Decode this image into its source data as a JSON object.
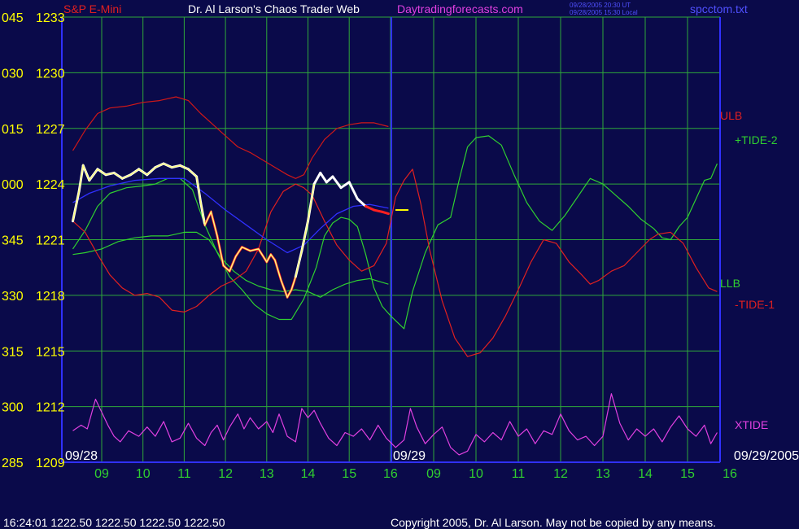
{
  "header": {
    "symbol": "S&P E-Mini",
    "title": "Dr. Al Larson's Chaos Trader Web",
    "site": "Daytradingforecasts.com",
    "time_ut": "09/28/2005 20:30 UT",
    "time_local": "09/28/2005 15:30 Local",
    "file": "spcctom.txt"
  },
  "footer": {
    "status": "16:24:01  1222.50  1222.50  1222.50  1222.50",
    "copyright": "Copyright 2005, Dr. Al Larson. May not be copied by any means."
  },
  "colors": {
    "background": "#0a0a4a",
    "grid": "#2fa83a",
    "price": "#ffffff",
    "price_down": "#ff2020",
    "ma_yellow": "#ffff80",
    "bands": "#d01818",
    "tide_plus": "#30d030",
    "tide_minus": "#e02020",
    "xtide": "#e040e0",
    "axis_blue": "#3030ff"
  },
  "chart_data": {
    "type": "line",
    "y_ticks": [
      {
        "angle": "045",
        "price": "1233"
      },
      {
        "angle": "030",
        "price": "1230"
      },
      {
        "angle": "015",
        "price": "1227"
      },
      {
        "angle": "000",
        "price": "1224"
      },
      {
        "angle": "345",
        "price": "1221"
      },
      {
        "angle": "330",
        "price": "1218"
      },
      {
        "angle": "315",
        "price": "1215"
      },
      {
        "angle": "300",
        "price": "1212"
      },
      {
        "angle": "285",
        "price": "1209"
      }
    ],
    "ylim": [
      1209,
      1233
    ],
    "x_ticks": [
      "09",
      "10",
      "11",
      "12",
      "13",
      "14",
      "15",
      "16",
      "09",
      "10",
      "11",
      "12",
      "13",
      "14",
      "15",
      "16"
    ],
    "date_labels": [
      "09/28",
      "09/29",
      "09/29/2005"
    ],
    "x_range_hours": [
      8.3,
      16
    ],
    "series_labels": {
      "ulb": "ULB",
      "tide_plus": "+TIDE-2",
      "llb": "LLB",
      "tide_minus": "-TIDE-1",
      "xtide": "XTIDE"
    },
    "price_path": [
      [
        8.3,
        1222.0
      ],
      [
        8.45,
        1223.6
      ],
      [
        8.55,
        1225.0
      ],
      [
        8.7,
        1224.2
      ],
      [
        8.9,
        1224.8
      ],
      [
        9.1,
        1224.5
      ],
      [
        9.3,
        1224.6
      ],
      [
        9.5,
        1224.3
      ],
      [
        9.7,
        1224.5
      ],
      [
        9.9,
        1224.8
      ],
      [
        10.1,
        1224.5
      ],
      [
        10.3,
        1224.9
      ],
      [
        10.5,
        1225.1
      ],
      [
        10.7,
        1224.9
      ],
      [
        10.9,
        1225.0
      ],
      [
        11.1,
        1224.8
      ],
      [
        11.3,
        1224.4
      ],
      [
        11.4,
        1223.0
      ],
      [
        11.5,
        1221.8
      ],
      [
        11.65,
        1222.5
      ],
      [
        11.8,
        1221.2
      ],
      [
        11.95,
        1219.6
      ],
      [
        12.1,
        1219.3
      ],
      [
        12.25,
        1220.1
      ],
      [
        12.4,
        1220.6
      ],
      [
        12.6,
        1220.4
      ],
      [
        12.8,
        1220.5
      ],
      [
        13.0,
        1219.8
      ],
      [
        13.1,
        1220.2
      ],
      [
        13.2,
        1219.9
      ],
      [
        13.35,
        1218.8
      ],
      [
        13.5,
        1217.9
      ],
      [
        13.6,
        1218.3
      ],
      [
        13.7,
        1219.0
      ],
      [
        13.85,
        1220.4
      ],
      [
        14.0,
        1222.0
      ],
      [
        14.15,
        1224.0
      ],
      [
        14.3,
        1224.6
      ],
      [
        14.45,
        1224.1
      ],
      [
        14.6,
        1224.4
      ],
      [
        14.8,
        1223.8
      ],
      [
        15.0,
        1224.1
      ],
      [
        15.2,
        1223.2
      ],
      [
        15.4,
        1222.8
      ],
      [
        15.6,
        1222.6
      ],
      [
        15.8,
        1222.5
      ],
      [
        15.95,
        1222.4
      ]
    ],
    "tide_plus_path": [
      [
        8.3,
        1220.5
      ],
      [
        8.6,
        1221.5
      ],
      [
        8.9,
        1222.8
      ],
      [
        9.2,
        1223.5
      ],
      [
        9.6,
        1223.8
      ],
      [
        10.0,
        1223.9
      ],
      [
        10.3,
        1224.0
      ],
      [
        10.6,
        1224.3
      ],
      [
        10.9,
        1224.3
      ],
      [
        11.2,
        1223.7
      ],
      [
        11.5,
        1221.8
      ],
      [
        11.8,
        1220.3
      ],
      [
        12.1,
        1219.0
      ],
      [
        12.4,
        1218.3
      ],
      [
        12.7,
        1217.5
      ],
      [
        13.0,
        1217.0
      ],
      [
        13.3,
        1216.7
      ],
      [
        13.6,
        1216.7
      ],
      [
        13.9,
        1217.8
      ],
      [
        14.2,
        1219.5
      ],
      [
        14.4,
        1221.2
      ],
      [
        14.6,
        1221.9
      ],
      [
        14.8,
        1222.2
      ],
      [
        15.0,
        1222.1
      ],
      [
        15.2,
        1221.7
      ],
      [
        15.4,
        1220.2
      ],
      [
        15.6,
        1218.4
      ],
      [
        15.8,
        1217.4
      ],
      [
        16.0,
        1216.9
      ],
      [
        16.3,
        1216.2
      ],
      [
        16.5,
        1218.2
      ],
      [
        16.8,
        1220.3
      ],
      [
        17.1,
        1221.8
      ],
      [
        17.4,
        1222.2
      ],
      [
        17.6,
        1224.2
      ],
      [
        17.8,
        1226.0
      ],
      [
        18.0,
        1226.5
      ],
      [
        18.3,
        1226.6
      ],
      [
        18.6,
        1226.1
      ],
      [
        18.9,
        1224.5
      ],
      [
        19.2,
        1223.0
      ],
      [
        19.5,
        1222.0
      ],
      [
        19.8,
        1221.5
      ],
      [
        20.1,
        1222.3
      ],
      [
        20.4,
        1223.3
      ],
      [
        20.7,
        1224.3
      ],
      [
        21.0,
        1224.0
      ],
      [
        21.3,
        1223.4
      ],
      [
        21.6,
        1222.8
      ],
      [
        21.9,
        1222.1
      ],
      [
        22.2,
        1221.6
      ],
      [
        22.4,
        1221.1
      ],
      [
        22.6,
        1221.0
      ],
      [
        22.8,
        1221.7
      ],
      [
        23.0,
        1222.2
      ],
      [
        23.2,
        1223.2
      ],
      [
        23.4,
        1224.2
      ],
      [
        23.55,
        1224.3
      ],
      [
        23.7,
        1225.1
      ]
    ],
    "tide_minus_path": [
      [
        8.3,
        1222.0
      ],
      [
        8.6,
        1221.4
      ],
      [
        8.9,
        1220.2
      ],
      [
        9.2,
        1219.1
      ],
      [
        9.5,
        1218.4
      ],
      [
        9.8,
        1218.0
      ],
      [
        10.1,
        1218.1
      ],
      [
        10.4,
        1217.9
      ],
      [
        10.7,
        1217.2
      ],
      [
        11.0,
        1217.1
      ],
      [
        11.3,
        1217.4
      ],
      [
        11.6,
        1218.0
      ],
      [
        11.9,
        1218.5
      ],
      [
        12.2,
        1218.8
      ],
      [
        12.5,
        1219.3
      ],
      [
        12.8,
        1220.5
      ],
      [
        13.1,
        1222.5
      ],
      [
        13.4,
        1223.6
      ],
      [
        13.7,
        1224.0
      ],
      [
        13.9,
        1223.8
      ],
      [
        14.1,
        1223.4
      ],
      [
        14.4,
        1222.0
      ],
      [
        14.7,
        1220.7
      ],
      [
        15.0,
        1219.9
      ],
      [
        15.3,
        1219.3
      ],
      [
        15.6,
        1219.6
      ],
      [
        15.9,
        1220.8
      ],
      [
        16.1,
        1223.3
      ],
      [
        16.3,
        1224.2
      ],
      [
        16.5,
        1224.8
      ],
      [
        16.7,
        1222.9
      ],
      [
        16.9,
        1220.5
      ],
      [
        17.2,
        1217.7
      ],
      [
        17.5,
        1215.7
      ],
      [
        17.8,
        1214.7
      ],
      [
        18.1,
        1214.9
      ],
      [
        18.4,
        1215.7
      ],
      [
        18.7,
        1216.9
      ],
      [
        19.0,
        1218.3
      ],
      [
        19.3,
        1219.8
      ],
      [
        19.6,
        1221.0
      ],
      [
        19.9,
        1220.8
      ],
      [
        20.2,
        1219.8
      ],
      [
        20.5,
        1219.1
      ],
      [
        20.7,
        1218.6
      ],
      [
        20.9,
        1218.8
      ],
      [
        21.2,
        1219.3
      ],
      [
        21.5,
        1219.6
      ],
      [
        21.8,
        1220.3
      ],
      [
        22.1,
        1221.0
      ],
      [
        22.3,
        1221.3
      ],
      [
        22.6,
        1221.4
      ],
      [
        22.9,
        1220.8
      ],
      [
        23.2,
        1219.5
      ],
      [
        23.5,
        1218.4
      ],
      [
        23.7,
        1218.2
      ]
    ],
    "ulb_path": [
      [
        8.3,
        1225.8
      ],
      [
        8.6,
        1226.9
      ],
      [
        8.9,
        1227.8
      ],
      [
        9.2,
        1228.1
      ],
      [
        9.6,
        1228.2
      ],
      [
        10.0,
        1228.4
      ],
      [
        10.4,
        1228.5
      ],
      [
        10.8,
        1228.7
      ],
      [
        11.1,
        1228.5
      ],
      [
        11.4,
        1227.8
      ],
      [
        11.7,
        1227.2
      ],
      [
        12.0,
        1226.6
      ],
      [
        12.3,
        1226.0
      ],
      [
        12.6,
        1225.7
      ],
      [
        12.9,
        1225.3
      ],
      [
        13.2,
        1224.9
      ],
      [
        13.5,
        1224.5
      ],
      [
        13.7,
        1224.3
      ],
      [
        13.9,
        1224.5
      ],
      [
        14.1,
        1225.4
      ],
      [
        14.4,
        1226.4
      ],
      [
        14.7,
        1227.0
      ],
      [
        15.0,
        1227.2
      ],
      [
        15.3,
        1227.3
      ],
      [
        15.6,
        1227.3
      ],
      [
        15.95,
        1227.1
      ]
    ],
    "llb_path": [
      [
        8.3,
        1220.2
      ],
      [
        8.6,
        1220.3
      ],
      [
        9.0,
        1220.5
      ],
      [
        9.4,
        1220.9
      ],
      [
        9.8,
        1221.1
      ],
      [
        10.2,
        1221.2
      ],
      [
        10.6,
        1221.2
      ],
      [
        11.0,
        1221.4
      ],
      [
        11.3,
        1221.4
      ],
      [
        11.6,
        1221.0
      ],
      [
        11.9,
        1220.0
      ],
      [
        12.2,
        1219.3
      ],
      [
        12.5,
        1218.8
      ],
      [
        12.8,
        1218.5
      ],
      [
        13.1,
        1218.3
      ],
      [
        13.4,
        1218.2
      ],
      [
        13.7,
        1218.3
      ],
      [
        14.0,
        1218.2
      ],
      [
        14.3,
        1217.9
      ],
      [
        14.6,
        1218.3
      ],
      [
        14.9,
        1218.6
      ],
      [
        15.2,
        1218.8
      ],
      [
        15.5,
        1218.9
      ],
      [
        15.95,
        1218.6
      ]
    ],
    "blue_ma_path": [
      [
        8.3,
        1223.0
      ],
      [
        8.7,
        1223.5
      ],
      [
        9.2,
        1223.9
      ],
      [
        9.8,
        1224.2
      ],
      [
        10.4,
        1224.3
      ],
      [
        11.0,
        1224.3
      ],
      [
        11.5,
        1223.5
      ],
      [
        12.0,
        1222.6
      ],
      [
        12.5,
        1221.8
      ],
      [
        13.0,
        1221.0
      ],
      [
        13.5,
        1220.3
      ],
      [
        13.9,
        1220.7
      ],
      [
        14.3,
        1221.6
      ],
      [
        14.7,
        1222.4
      ],
      [
        15.1,
        1222.8
      ],
      [
        15.5,
        1222.9
      ],
      [
        15.95,
        1222.7
      ]
    ],
    "xtide_path": [
      [
        8.3,
        1210.7
      ],
      [
        8.5,
        1211.0
      ],
      [
        8.65,
        1210.8
      ],
      [
        8.85,
        1212.4
      ],
      [
        9.0,
        1211.7
      ],
      [
        9.15,
        1211.0
      ],
      [
        9.3,
        1210.4
      ],
      [
        9.45,
        1210.1
      ],
      [
        9.65,
        1210.7
      ],
      [
        9.9,
        1210.4
      ],
      [
        10.1,
        1210.9
      ],
      [
        10.3,
        1210.4
      ],
      [
        10.5,
        1211.2
      ],
      [
        10.7,
        1210.1
      ],
      [
        10.9,
        1210.3
      ],
      [
        11.1,
        1211.1
      ],
      [
        11.3,
        1210.3
      ],
      [
        11.5,
        1209.9
      ],
      [
        11.65,
        1210.6
      ],
      [
        11.8,
        1211.0
      ],
      [
        11.95,
        1210.2
      ],
      [
        12.1,
        1210.9
      ],
      [
        12.3,
        1211.6
      ],
      [
        12.45,
        1210.8
      ],
      [
        12.6,
        1211.4
      ],
      [
        12.8,
        1210.8
      ],
      [
        13.0,
        1211.2
      ],
      [
        13.15,
        1210.6
      ],
      [
        13.3,
        1211.6
      ],
      [
        13.5,
        1210.4
      ],
      [
        13.7,
        1210.1
      ],
      [
        13.85,
        1211.9
      ],
      [
        14.0,
        1211.4
      ],
      [
        14.15,
        1211.8
      ],
      [
        14.3,
        1211.1
      ],
      [
        14.5,
        1210.3
      ],
      [
        14.7,
        1209.9
      ],
      [
        14.9,
        1210.6
      ],
      [
        15.1,
        1210.4
      ],
      [
        15.3,
        1210.8
      ],
      [
        15.5,
        1210.2
      ],
      [
        15.7,
        1211.0
      ],
      [
        15.9,
        1210.3
      ],
      [
        16.1,
        1209.8
      ],
      [
        16.3,
        1210.2
      ],
      [
        16.45,
        1211.9
      ],
      [
        16.6,
        1210.9
      ],
      [
        16.8,
        1210.0
      ],
      [
        17.0,
        1210.5
      ],
      [
        17.2,
        1210.9
      ],
      [
        17.4,
        1209.8
      ],
      [
        17.6,
        1209.4
      ],
      [
        17.8,
        1209.6
      ],
      [
        18.0,
        1210.5
      ],
      [
        18.2,
        1210.1
      ],
      [
        18.4,
        1210.6
      ],
      [
        18.6,
        1210.2
      ],
      [
        18.8,
        1211.2
      ],
      [
        19.0,
        1210.4
      ],
      [
        19.2,
        1210.8
      ],
      [
        19.4,
        1210.0
      ],
      [
        19.6,
        1210.7
      ],
      [
        19.8,
        1210.5
      ],
      [
        20.0,
        1211.6
      ],
      [
        20.2,
        1210.7
      ],
      [
        20.4,
        1210.2
      ],
      [
        20.6,
        1210.4
      ],
      [
        20.8,
        1209.9
      ],
      [
        21.0,
        1210.4
      ],
      [
        21.2,
        1212.7
      ],
      [
        21.4,
        1211.1
      ],
      [
        21.6,
        1210.2
      ],
      [
        21.8,
        1210.8
      ],
      [
        22.0,
        1210.4
      ],
      [
        22.2,
        1210.8
      ],
      [
        22.4,
        1210.1
      ],
      [
        22.6,
        1210.9
      ],
      [
        22.8,
        1211.5
      ],
      [
        23.0,
        1210.8
      ],
      [
        23.2,
        1210.4
      ],
      [
        23.4,
        1211.0
      ],
      [
        23.55,
        1210.0
      ],
      [
        23.7,
        1210.6
      ]
    ],
    "last_price_marker": [
      16.25,
      1222.6
    ]
  }
}
